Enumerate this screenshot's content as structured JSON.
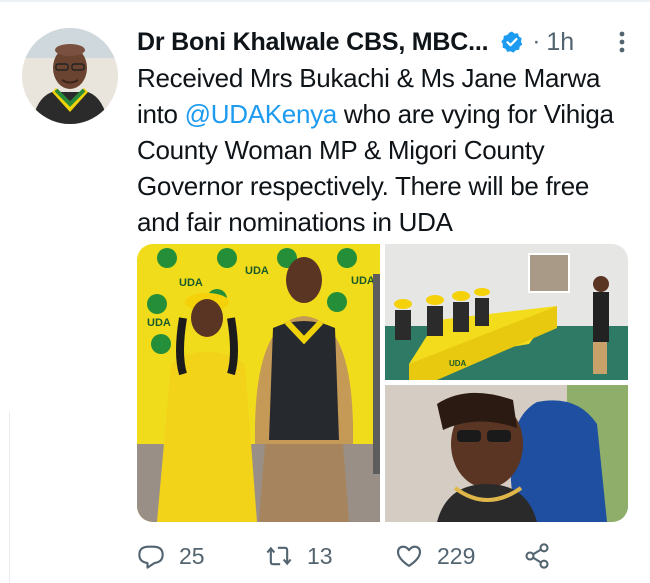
{
  "tweet": {
    "author": "Dr Boni Khalwale CBS, MBC...",
    "separator": "·",
    "time": "1h",
    "text_before": "Received Mrs Bukachi & Ms Jane Marwa into ",
    "mention": "@UDAKenya",
    "text_after": " who are vying for Vihiga County Woman MP & Migori County Governor respectively. There will be free and fair nominations in UDA"
  },
  "media": {
    "banner_text": "UDA",
    "table_text": "UDA"
  },
  "actions": {
    "replies": "25",
    "retweets": "13",
    "likes": "229"
  },
  "icons": {
    "verified": "verified-badge-icon",
    "more": "more-options-icon",
    "reply": "reply-icon",
    "retweet": "retweet-icon",
    "like": "heart-icon",
    "share": "share-icon"
  },
  "colors": {
    "accent": "#1d9bf0",
    "muted": "#536471",
    "text": "#0f1419",
    "uda_yellow": "#f5d90a",
    "uda_green": "#1a8a3a"
  }
}
